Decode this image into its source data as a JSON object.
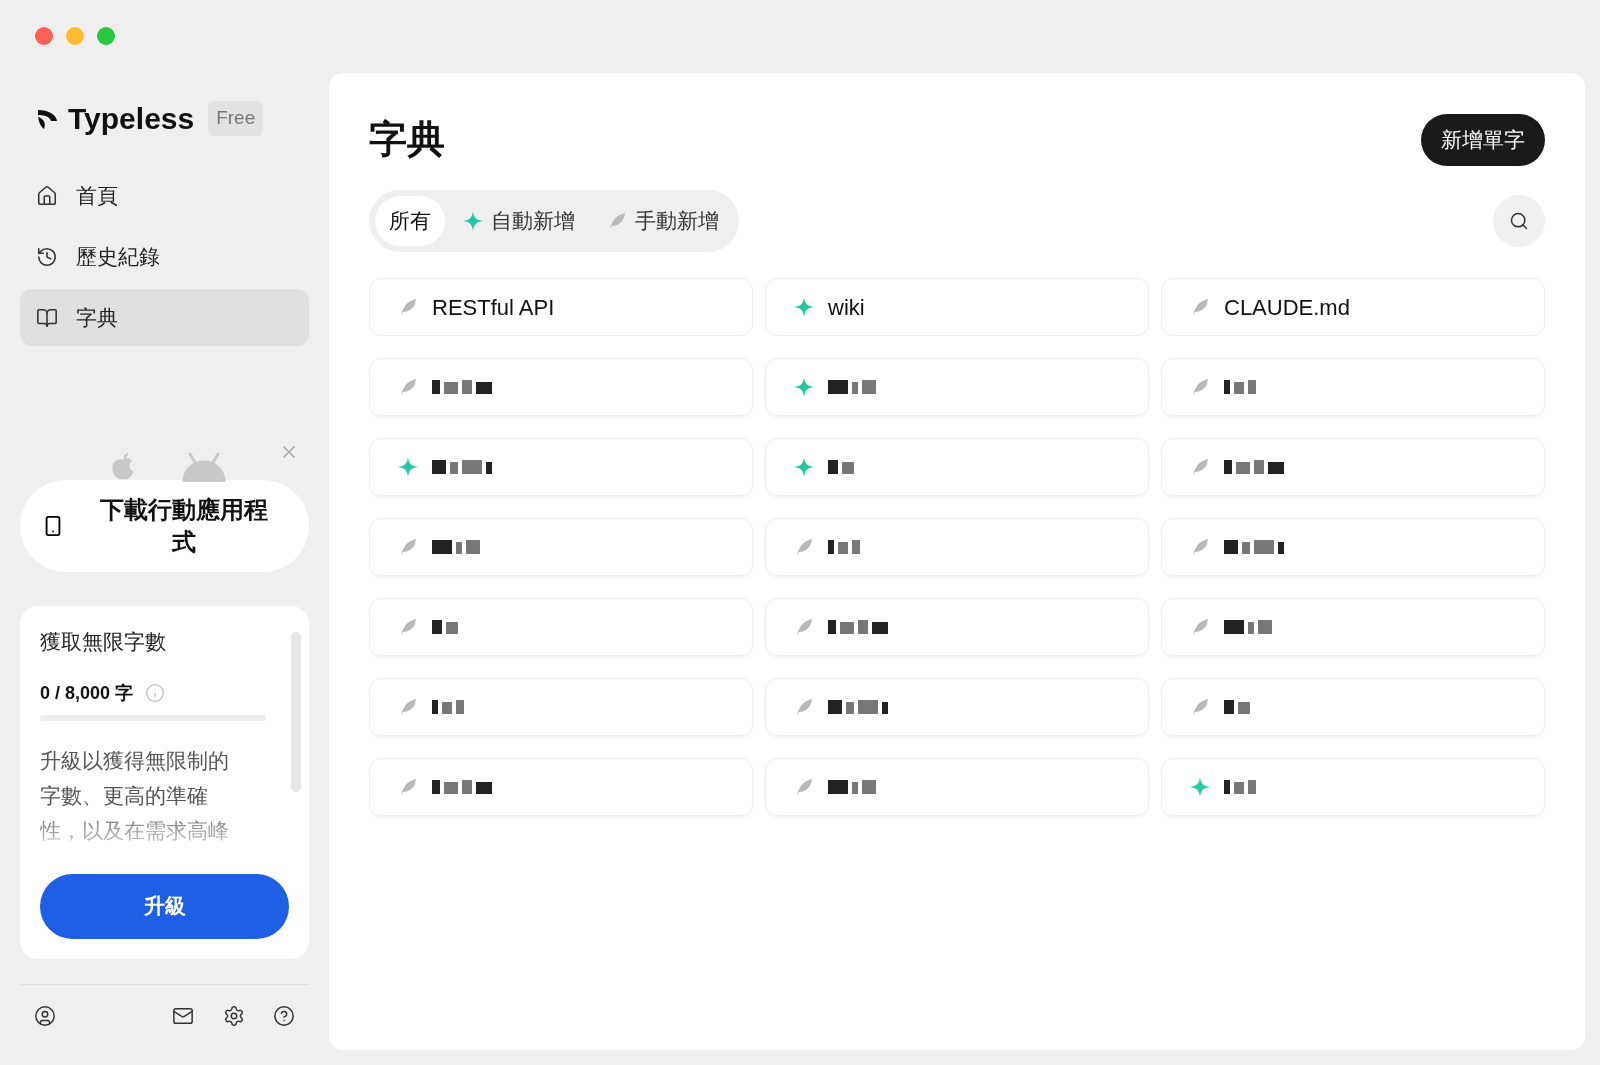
{
  "sidebar": {
    "brand": "Typeless",
    "plan_badge": "Free",
    "nav": [
      {
        "label": "首頁",
        "selected": false
      },
      {
        "label": "歷史紀錄",
        "selected": false
      },
      {
        "label": "字典",
        "selected": true
      }
    ],
    "promo": {
      "button": "下載行動應用程式"
    },
    "usage_card": {
      "title": "獲取無限字數",
      "count": "0 / 8,000 字",
      "level": 0,
      "description": "升級以獲得無限制的字數、更高的準確性，以及在需求高峰",
      "button": "升級"
    }
  },
  "main": {
    "title": "字典",
    "add_button": "新增單字",
    "filters": [
      {
        "label": "所有",
        "selected": true
      },
      {
        "label": "自動新增",
        "selected": false
      },
      {
        "label": "手動新增",
        "selected": false
      }
    ],
    "entries": [
      {
        "kind": "word",
        "auto_added": false,
        "text": "RESTful API"
      },
      {
        "kind": "word",
        "auto_added": true,
        "text": "wiki"
      },
      {
        "kind": "word",
        "auto_added": false,
        "text": "CLAUDE.md"
      },
      {
        "kind": "redacted",
        "auto_added": false
      },
      {
        "kind": "redacted",
        "auto_added": true
      },
      {
        "kind": "redacted",
        "auto_added": false
      },
      {
        "kind": "redacted",
        "auto_added": true
      },
      {
        "kind": "redacted",
        "auto_added": true
      },
      {
        "kind": "redacted",
        "auto_added": false
      },
      {
        "kind": "redacted",
        "auto_added": false
      },
      {
        "kind": "redacted",
        "auto_added": false
      },
      {
        "kind": "redacted",
        "auto_added": false
      },
      {
        "kind": "redacted",
        "auto_added": false
      },
      {
        "kind": "redacted",
        "auto_added": false
      },
      {
        "kind": "redacted",
        "auto_added": false
      },
      {
        "kind": "redacted",
        "auto_added": false
      },
      {
        "kind": "redacted",
        "auto_added": false
      },
      {
        "kind": "redacted",
        "auto_added": false
      },
      {
        "kind": "redacted",
        "auto_added": false
      },
      {
        "kind": "redacted",
        "auto_added": false
      },
      {
        "kind": "redacted",
        "auto_added": true
      }
    ]
  }
}
